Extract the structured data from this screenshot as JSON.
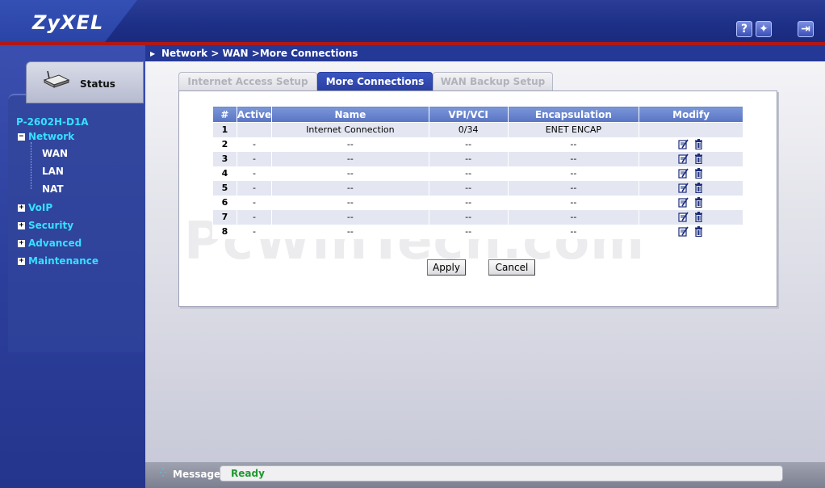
{
  "header": {
    "logo": "ZyXEL",
    "help_icon": "question-icon",
    "wizard_icon": "wizard-icon",
    "logout_icon": "logout-icon"
  },
  "sidebar": {
    "status_label": "Status",
    "device_name": "P-2602H-D1A",
    "menu": [
      {
        "label": "Network",
        "expanded": true,
        "children": [
          "WAN",
          "LAN",
          "NAT"
        ]
      },
      {
        "label": "VoIP",
        "expanded": false
      },
      {
        "label": "Security",
        "expanded": false
      },
      {
        "label": "Advanced",
        "expanded": false
      },
      {
        "label": "Maintenance",
        "expanded": false
      }
    ]
  },
  "breadcrumb": "Network > WAN >More Connections",
  "tabs": [
    {
      "label": "Internet Access Setup",
      "active": false
    },
    {
      "label": "More Connections",
      "active": true
    },
    {
      "label": "WAN Backup Setup",
      "active": false
    }
  ],
  "table": {
    "headers": [
      "#",
      "Active",
      "Name",
      "VPI/VCI",
      "Encapsulation",
      "Modify"
    ],
    "rows": [
      {
        "num": "1",
        "active": "",
        "name": "Internet Connection",
        "vpi": "0/34",
        "encap": "ENET ENCAP",
        "modify": false
      },
      {
        "num": "2",
        "active": "-",
        "name": "--",
        "vpi": "--",
        "encap": "--",
        "modify": true
      },
      {
        "num": "3",
        "active": "-",
        "name": "--",
        "vpi": "--",
        "encap": "--",
        "modify": true
      },
      {
        "num": "4",
        "active": "-",
        "name": "--",
        "vpi": "--",
        "encap": "--",
        "modify": true
      },
      {
        "num": "5",
        "active": "-",
        "name": "--",
        "vpi": "--",
        "encap": "--",
        "modify": true
      },
      {
        "num": "6",
        "active": "-",
        "name": "--",
        "vpi": "--",
        "encap": "--",
        "modify": true
      },
      {
        "num": "7",
        "active": "-",
        "name": "--",
        "vpi": "--",
        "encap": "--",
        "modify": true
      },
      {
        "num": "8",
        "active": "-",
        "name": "--",
        "vpi": "--",
        "encap": "--",
        "modify": true
      }
    ]
  },
  "watermark": "PcWinTech.com",
  "buttons": {
    "apply": "Apply",
    "cancel": "Cancel"
  },
  "message": {
    "label": "Message",
    "value": "Ready"
  },
  "colors": {
    "brand": "#2a3d97",
    "accent": "#36e0ff",
    "ready": "#1e9a2e"
  }
}
